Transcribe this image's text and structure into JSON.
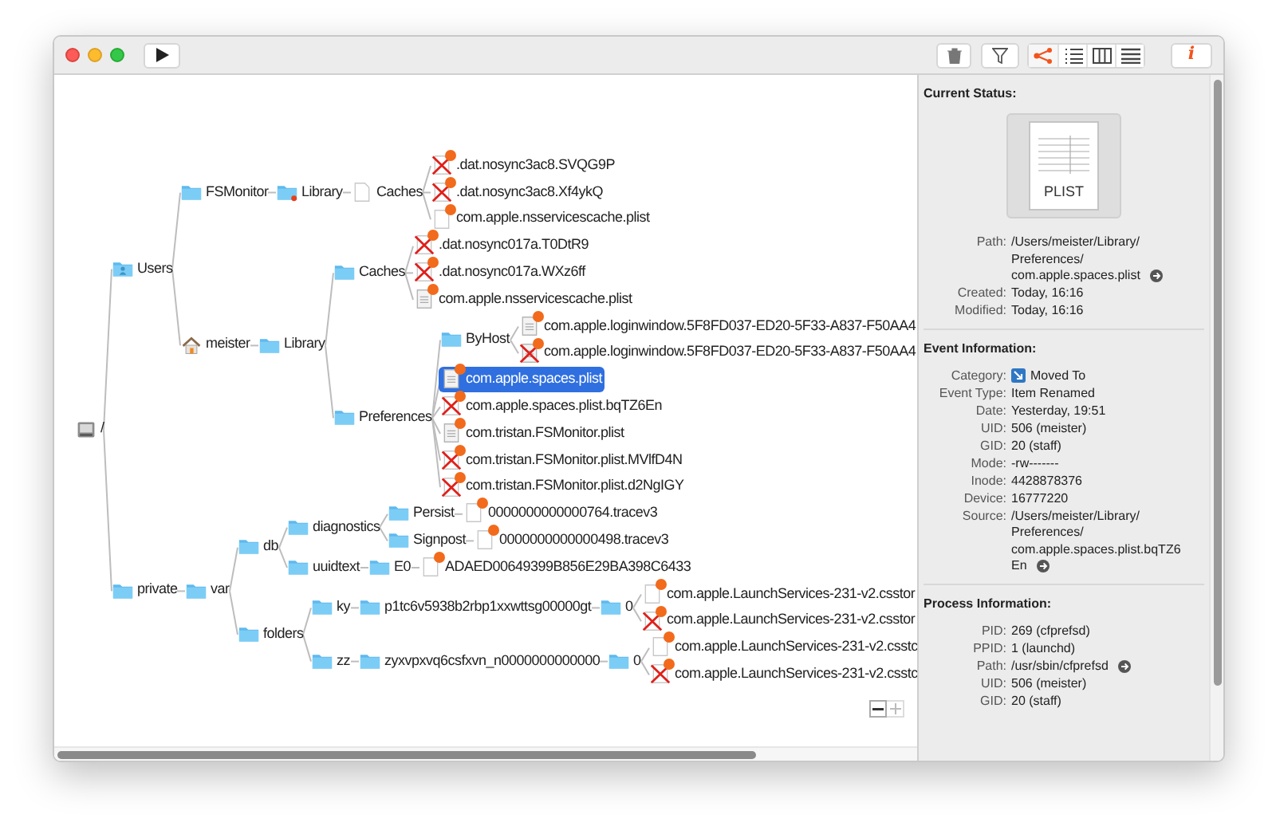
{
  "toolbar": {
    "view_modes": [
      {
        "kind": "tree",
        "selected": true
      },
      {
        "kind": "list",
        "selected": false
      },
      {
        "kind": "columns",
        "selected": false
      },
      {
        "kind": "lines",
        "selected": false
      }
    ],
    "info_label": "i"
  },
  "tree": {
    "label": "/",
    "kind": "disk",
    "selected": false,
    "deleted": false,
    "badge": false,
    "children": [
      {
        "label": "Users",
        "kind": "users-folder",
        "selected": false,
        "deleted": false,
        "badge": false,
        "children": [
          {
            "label": "FSMonitor",
            "kind": "folder",
            "selected": false,
            "deleted": false,
            "badge": false,
            "children": [
              {
                "label": "Library",
                "kind": "folder-alert",
                "selected": false,
                "deleted": false,
                "badge": false,
                "children": [
                  {
                    "label": "Caches",
                    "kind": "document",
                    "selected": false,
                    "deleted": false,
                    "badge": false,
                    "children": [
                      {
                        "label": ".dat.nosync3ac8.SVQG9P",
                        "kind": "document",
                        "selected": false,
                        "deleted": true,
                        "badge": true
                      },
                      {
                        "label": ".dat.nosync3ac8.Xf4ykQ",
                        "kind": "document",
                        "selected": false,
                        "deleted": true,
                        "badge": true
                      },
                      {
                        "label": "com.apple.nsservicescache.plist",
                        "kind": "document",
                        "selected": false,
                        "deleted": false,
                        "badge": true
                      }
                    ]
                  }
                ]
              }
            ]
          },
          {
            "label": "meister",
            "kind": "home",
            "selected": false,
            "deleted": false,
            "badge": false,
            "children": [
              {
                "label": "Library",
                "kind": "folder",
                "selected": false,
                "deleted": false,
                "badge": false,
                "children": [
                  {
                    "label": "Caches",
                    "kind": "folder",
                    "selected": false,
                    "deleted": false,
                    "badge": false,
                    "children": [
                      {
                        "label": ".dat.nosync017a.T0DtR9",
                        "kind": "document",
                        "selected": false,
                        "deleted": true,
                        "badge": true
                      },
                      {
                        "label": ".dat.nosync017a.WXz6ff",
                        "kind": "document",
                        "selected": false,
                        "deleted": true,
                        "badge": true
                      },
                      {
                        "label": "com.apple.nsservicescache.plist",
                        "kind": "plist",
                        "selected": false,
                        "deleted": false,
                        "badge": true
                      }
                    ]
                  },
                  {
                    "label": "Preferences",
                    "kind": "folder",
                    "selected": false,
                    "deleted": false,
                    "badge": false,
                    "children": [
                      {
                        "label": "ByHost",
                        "kind": "folder",
                        "selected": false,
                        "deleted": false,
                        "badge": false,
                        "children": [
                          {
                            "label": "com.apple.loginwindow.5F8FD037-ED20-5F33-A837-F50AA4",
                            "kind": "plist",
                            "selected": false,
                            "deleted": false,
                            "badge": true
                          },
                          {
                            "label": "com.apple.loginwindow.5F8FD037-ED20-5F33-A837-F50AA4",
                            "kind": "plist",
                            "selected": false,
                            "deleted": true,
                            "badge": true
                          }
                        ]
                      },
                      {
                        "label": "com.apple.spaces.plist",
                        "kind": "plist",
                        "selected": true,
                        "deleted": false,
                        "badge": true
                      },
                      {
                        "label": "com.apple.spaces.plist.bqTZ6En",
                        "kind": "document",
                        "selected": false,
                        "deleted": true,
                        "badge": true
                      },
                      {
                        "label": "com.tristan.FSMonitor.plist",
                        "kind": "plist",
                        "selected": false,
                        "deleted": false,
                        "badge": true
                      },
                      {
                        "label": "com.tristan.FSMonitor.plist.MVlfD4N",
                        "kind": "document",
                        "selected": false,
                        "deleted": true,
                        "badge": true
                      },
                      {
                        "label": "com.tristan.FSMonitor.plist.d2NgIGY",
                        "kind": "document",
                        "selected": false,
                        "deleted": true,
                        "badge": true
                      }
                    ]
                  }
                ]
              }
            ]
          }
        ]
      },
      {
        "label": "private",
        "kind": "folder",
        "selected": false,
        "deleted": false,
        "badge": false,
        "children": [
          {
            "label": "var",
            "kind": "folder",
            "selected": false,
            "deleted": false,
            "badge": false,
            "children": [
              {
                "label": "db",
                "kind": "folder",
                "selected": false,
                "deleted": false,
                "badge": false,
                "children": [
                  {
                    "label": "diagnostics",
                    "kind": "folder",
                    "selected": false,
                    "deleted": false,
                    "badge": false,
                    "children": [
                      {
                        "label": "Persist",
                        "kind": "folder",
                        "selected": false,
                        "deleted": false,
                        "badge": false,
                        "children": [
                          {
                            "label": "0000000000000764.tracev3",
                            "kind": "document",
                            "selected": false,
                            "deleted": false,
                            "badge": true
                          }
                        ]
                      },
                      {
                        "label": "Signpost",
                        "kind": "folder",
                        "selected": false,
                        "deleted": false,
                        "badge": false,
                        "children": [
                          {
                            "label": "0000000000000498.tracev3",
                            "kind": "document",
                            "selected": false,
                            "deleted": false,
                            "badge": true
                          }
                        ]
                      }
                    ]
                  },
                  {
                    "label": "uuidtext",
                    "kind": "folder",
                    "selected": false,
                    "deleted": false,
                    "badge": false,
                    "children": [
                      {
                        "label": "E0",
                        "kind": "folder",
                        "selected": false,
                        "deleted": false,
                        "badge": false,
                        "children": [
                          {
                            "label": "ADAED00649399B856E29BA398C6433",
                            "kind": "document",
                            "selected": false,
                            "deleted": false,
                            "badge": true
                          }
                        ]
                      }
                    ]
                  }
                ]
              },
              {
                "label": "folders",
                "kind": "folder",
                "selected": false,
                "deleted": false,
                "badge": false,
                "children": [
                  {
                    "label": "ky",
                    "kind": "folder",
                    "selected": false,
                    "deleted": false,
                    "badge": false,
                    "children": [
                      {
                        "label": "p1tc6v5938b2rbp1xxwttsg00000gt",
                        "kind": "folder",
                        "selected": false,
                        "deleted": false,
                        "badge": false,
                        "children": [
                          {
                            "label": "0",
                            "kind": "folder",
                            "selected": false,
                            "deleted": false,
                            "badge": false,
                            "children": [
                              {
                                "label": "com.apple.LaunchServices-231-v2.csstor",
                                "kind": "document",
                                "selected": false,
                                "deleted": false,
                                "badge": true
                              },
                              {
                                "label": "com.apple.LaunchServices-231-v2.csstor",
                                "kind": "document",
                                "selected": false,
                                "deleted": true,
                                "badge": true
                              }
                            ]
                          }
                        ]
                      }
                    ]
                  },
                  {
                    "label": "zz",
                    "kind": "folder",
                    "selected": false,
                    "deleted": false,
                    "badge": false,
                    "children": [
                      {
                        "label": "zyxvpxvq6csfxvn_n0000000000000",
                        "kind": "folder",
                        "selected": false,
                        "deleted": false,
                        "badge": false,
                        "children": [
                          {
                            "label": "0",
                            "kind": "folder",
                            "selected": false,
                            "deleted": false,
                            "badge": false,
                            "children": [
                              {
                                "label": "com.apple.LaunchServices-231-v2.csstc",
                                "kind": "document",
                                "selected": false,
                                "deleted": false,
                                "badge": true
                              },
                              {
                                "label": "com.apple.LaunchServices-231-v2.csstc",
                                "kind": "document",
                                "selected": false,
                                "deleted": true,
                                "badge": true
                              }
                            ]
                          }
                        ]
                      }
                    ]
                  }
                ]
              }
            ]
          }
        ]
      }
    ]
  },
  "inspector": {
    "sections": [
      {
        "title": "Current Status:",
        "preview": {
          "label": "PLIST"
        },
        "rows": [
          {
            "label": "Path:",
            "lines": [
              "/Users/meister/Library/",
              "Preferences/",
              "com.apple.spaces.plist"
            ],
            "reveal": true
          },
          {
            "label": "Created:",
            "lines": [
              "Today, 16:16"
            ],
            "reveal": false
          },
          {
            "label": "Modified:",
            "lines": [
              "Today, 16:16"
            ],
            "reveal": false
          }
        ]
      },
      {
        "title": "Event Information:",
        "rows": [
          {
            "label": "Category:",
            "lines": [
              "Moved To"
            ],
            "reveal": false,
            "kind": "category"
          },
          {
            "label": "Event Type:",
            "lines": [
              "Item Renamed"
            ],
            "reveal": false
          },
          {
            "label": "Date:",
            "lines": [
              "Yesterday, 19:51"
            ],
            "reveal": false
          },
          {
            "label": "UID:",
            "lines": [
              "506 (meister)"
            ],
            "reveal": false
          },
          {
            "label": "GID:",
            "lines": [
              "20 (staff)"
            ],
            "reveal": false
          },
          {
            "label": "Mode:",
            "lines": [
              "-rw-------"
            ],
            "reveal": false
          },
          {
            "label": "Inode:",
            "lines": [
              "4428878376"
            ],
            "reveal": false
          },
          {
            "label": "Device:",
            "lines": [
              "16777220"
            ],
            "reveal": false
          },
          {
            "label": "Source:",
            "lines": [
              "/Users/meister/Library/",
              "Preferences/",
              "com.apple.spaces.plist.bqTZ6",
              "En"
            ],
            "reveal": true
          }
        ]
      },
      {
        "title": "Process Information:",
        "rows": [
          {
            "label": "PID:",
            "lines": [
              "269 (cfprefsd)"
            ],
            "reveal": false
          },
          {
            "label": "PPID:",
            "lines": [
              "1 (launchd)"
            ],
            "reveal": false
          },
          {
            "label": "Path:",
            "lines": [
              "/usr/sbin/cfprefsd"
            ],
            "reveal": true
          },
          {
            "label": "UID:",
            "lines": [
              "506 (meister)"
            ],
            "reveal": false
          },
          {
            "label": "GID:",
            "lines": [
              "20 (staff)"
            ],
            "reveal": false
          }
        ]
      }
    ]
  }
}
